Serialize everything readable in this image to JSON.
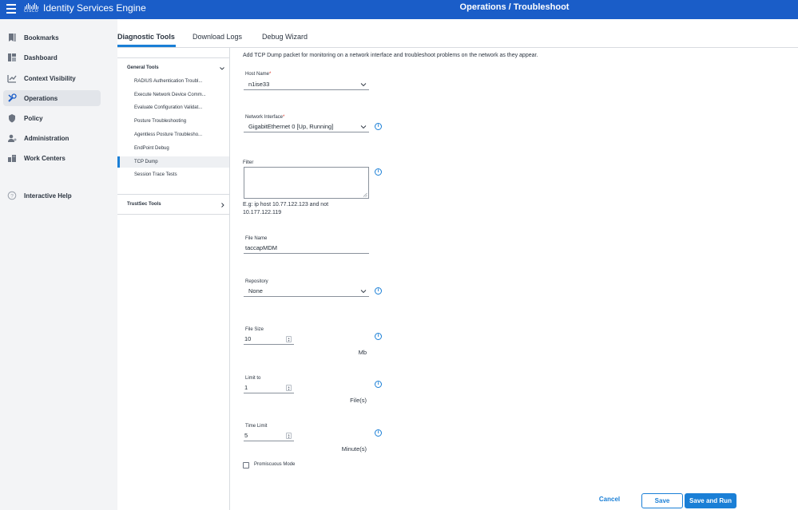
{
  "header": {
    "app_title": "Identity Services Engine",
    "page_title": "Operations / Troubleshoot",
    "logo_text": "CISCO",
    "brand_color": "#1a5dc8"
  },
  "sidebar": {
    "items": [
      {
        "label": "Bookmarks",
        "icon": "bookmark-icon",
        "active": false
      },
      {
        "label": "Dashboard",
        "icon": "dashboard-icon",
        "active": false
      },
      {
        "label": "Context Visibility",
        "icon": "context-visibility-icon",
        "active": false
      },
      {
        "label": "Operations",
        "icon": "wrench-icon",
        "active": true
      },
      {
        "label": "Policy",
        "icon": "shield-icon",
        "active": false
      },
      {
        "label": "Administration",
        "icon": "admin-user-icon",
        "active": false
      },
      {
        "label": "Work Centers",
        "icon": "work-centers-icon",
        "active": false
      },
      {
        "label": "Interactive Help",
        "icon": "help-icon",
        "active": false
      }
    ]
  },
  "tabs": [
    {
      "label": "Diagnostic Tools",
      "active": true
    },
    {
      "label": "Download Logs",
      "active": false
    },
    {
      "label": "Debug Wizard",
      "active": false
    }
  ],
  "tools_tree": {
    "general_tools": {
      "label": "General Tools",
      "items": [
        "RADIUS Authentication Troubl...",
        "Execute Network Device Comm...",
        "Evaluate Configuration Validat...",
        "Posture Troubleshooting",
        "Agentless Posture Troublesho...",
        "EndPoint Debug",
        "TCP Dump",
        "Session Trace Tests"
      ],
      "selected": "TCP Dump"
    },
    "trustsec_tools": {
      "label": "TrustSec Tools"
    }
  },
  "form": {
    "description": "Add TCP Dump packet for monitoring on a network interface and troubleshoot problems on the network as they appear.",
    "host_name": {
      "label": "Host Name",
      "required_mark": "*",
      "value": "n1ise33"
    },
    "network_interface": {
      "label": "Network Interface",
      "required_mark": "*",
      "value": "GigabitEthernet 0 [Up, Running]"
    },
    "filter": {
      "label": "Filter",
      "value": "",
      "hint": "E.g: ip host 10.77.122.123 and not 10.177.122.119"
    },
    "file_name": {
      "label": "File Name",
      "value": "taccapMDM"
    },
    "repository": {
      "label": "Repository",
      "value": "None"
    },
    "file_size": {
      "label": "File Size",
      "value": "10",
      "unit": "Mb"
    },
    "limit_to": {
      "label": "Limit to",
      "value": "1",
      "unit": "File(s)"
    },
    "time_limit": {
      "label": "Time Limit",
      "value": "5",
      "unit": "Minute(s)"
    },
    "promiscuous_mode": {
      "label": "Promiscuous Mode",
      "checked": false
    },
    "info_glyph": "i"
  },
  "footer": {
    "cancel_label": "Cancel",
    "save_label": "Save",
    "save_run_label": "Save and Run"
  }
}
